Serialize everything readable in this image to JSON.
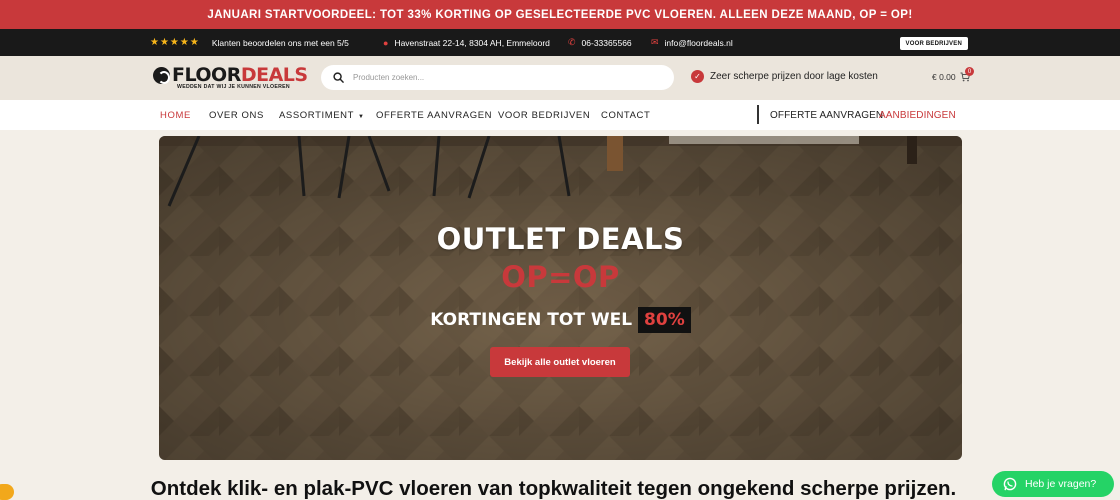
{
  "promo": {
    "text": "JANUARI STARTVOORDEEL: TOT 33% KORTING OP GESELECTEERDE PVC VLOEREN. ALLEEN DEZE MAAND, OP = OP!"
  },
  "infobar": {
    "stars": "★★★★★",
    "rating": "Klanten beoordelen ons met een 5/5",
    "address": "Havenstraat 22-14, 8304 AH, Emmeloord",
    "phone": "06-33365566",
    "email": "info@floordeals.nl",
    "business_button": "VOOR BEDRIJVEN"
  },
  "header": {
    "logo_floor": "FLOOR",
    "logo_deals": "DEALS",
    "logo_tagline": "WEDDEN DAT WIJ JE KUNNEN VLOEREN",
    "search_placeholder": "Producten zoeken...",
    "claim": "Zeer scherpe prijzen door lage kosten",
    "cart_total": "€ 0.00",
    "cart_count": "0"
  },
  "nav": {
    "items": [
      {
        "label": "HOME"
      },
      {
        "label": "OVER ONS"
      },
      {
        "label": "ASSORTIMENT"
      },
      {
        "label": "OFFERTE AANVRAGEN"
      },
      {
        "label": "VOOR BEDRIJVEN"
      },
      {
        "label": "CONTACT"
      }
    ],
    "right_quote": "OFFERTE AANVRAGEN",
    "right_deals": "AANBIEDINGEN"
  },
  "hero": {
    "title": "OUTLET DEALS",
    "subtitle": "OP=OP",
    "discount_text": "KORTINGEN TOT WEL",
    "discount_pct": "80%",
    "cta": "Bekijk alle outlet vloeren"
  },
  "main": {
    "heading": "Ontdek klik- en plak-PVC vloeren van topkwaliteit tegen ongekend scherpe prijzen."
  },
  "chat": {
    "label": "Heb je vragen?"
  },
  "colors": {
    "accent": "#c8393b",
    "dark": "#191919",
    "whatsapp": "#25d366",
    "header_bg": "#ebe5dc"
  }
}
